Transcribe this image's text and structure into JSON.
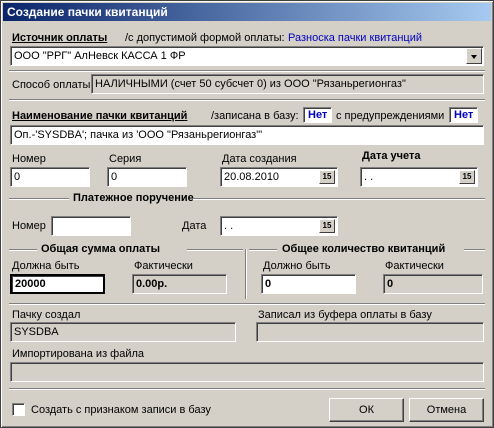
{
  "window": {
    "title": "Создание пачки квитанций"
  },
  "source": {
    "label": "Источник оплаты",
    "note": "/с допустимой формой оплаты:",
    "link": "Разноска пачки квитанций",
    "value": "ООО \"РРГ\" АлНевск КАССА 1 ФР"
  },
  "payment_method": {
    "label": "Способ оплаты",
    "value": "НАЛИЧНЫМИ (счет 50 субсчет 0) из ООО \"Рязаньрегионгаз\""
  },
  "batch_name": {
    "label": "Наименование пачки квитанций",
    "written_label": "/записана в базу:",
    "written_value": "Нет",
    "warnings_label": "с предупреждениями",
    "warnings_value": "Нет",
    "value": "Оп.-'SYSDBA'; пачка из 'ООО \"Рязаньрегионгаз\"'"
  },
  "number": {
    "label": "Номер",
    "value": "0"
  },
  "series": {
    "label": "Серия",
    "value": "0"
  },
  "created_date": {
    "label": "Дата создания",
    "value": "20.08.2010"
  },
  "accounting_date": {
    "label": "Дата учета",
    "value": " .  ."
  },
  "payment_order": {
    "title": "Платежное поручение",
    "number_label": "Номер",
    "number_value": "",
    "date_label": "Дата",
    "date_value": " .  ."
  },
  "total_sum": {
    "title": "Общая сумма оплаты",
    "expected_label": "Должна быть",
    "expected_value": "20000",
    "actual_label": "Фактически",
    "actual_value": "0.00р."
  },
  "total_count": {
    "title": "Общее количество квитанций",
    "expected_label": "Должно быть",
    "expected_value": "0",
    "actual_label": "Фактически",
    "actual_value": "0"
  },
  "created_by": {
    "label": "Пачку создал",
    "value": "SYSDBA"
  },
  "buffer_record": {
    "label": "Записал из буфера оплаты в базу",
    "value": ""
  },
  "imported_from": {
    "label": "Импортирована из файла",
    "value": ""
  },
  "create_flag": {
    "label": "Создать с признаком записи в базу",
    "checked": false
  },
  "buttons": {
    "ok": "ОК",
    "cancel": "Отмена"
  },
  "calendar_icon_text": "15"
}
